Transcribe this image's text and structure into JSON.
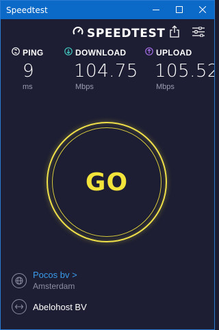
{
  "window": {
    "title": "Speedtest",
    "minimize_icon": "minimize-icon",
    "maximize_icon": "maximize-icon",
    "close_icon": "close-icon"
  },
  "brand": {
    "name": "SPEEDTEST",
    "logo_icon": "speedometer-icon"
  },
  "toolbar": {
    "share_icon": "share-icon",
    "settings_icon": "settings-sliders-icon"
  },
  "metrics": {
    "ping": {
      "label": "PING",
      "value": "9",
      "unit": "ms",
      "icon": "ping-icon",
      "color": "#ffffff"
    },
    "download": {
      "label": "DOWNLOAD",
      "value": "104.75",
      "unit": "Mbps",
      "icon": "download-arrow-icon",
      "color": "#43c9c0"
    },
    "upload": {
      "label": "UPLOAD",
      "value": "105.52",
      "unit": "Mbps",
      "icon": "upload-arrow-icon",
      "color": "#a56ee8"
    }
  },
  "go_button": {
    "label": "GO",
    "color": "#f3e43c"
  },
  "isp": {
    "name": "Pocos bv",
    "chevron": ">",
    "location": "Amsterdam",
    "icon": "globe-icon"
  },
  "host": {
    "name": "Abelohost BV",
    "icon": "server-arrows-icon"
  },
  "colors": {
    "titlebar": "#0b69c7",
    "background": "#1d1e33",
    "link": "#3a9bea"
  }
}
